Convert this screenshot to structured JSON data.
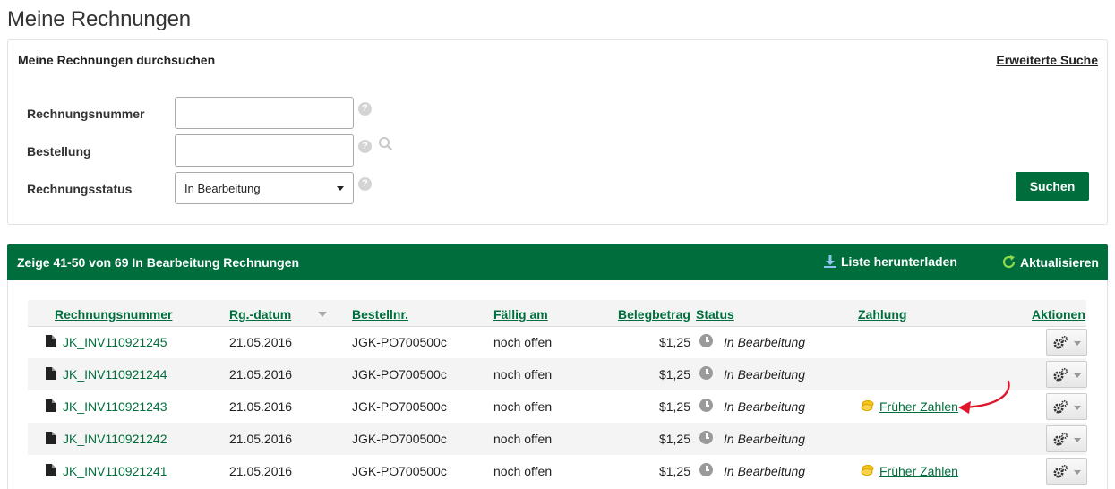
{
  "page": {
    "title": "Meine Rechnungen"
  },
  "search": {
    "title": "Meine Rechnungen durchsuchen",
    "advanced_link": "Erweiterte Suche",
    "fields": {
      "invoice_number_label": "Rechnungsnummer",
      "invoice_number_value": "",
      "order_label": "Bestellung",
      "order_value": "",
      "status_label": "Rechnungsstatus",
      "status_value": "In Bearbeitung"
    },
    "help_glyph": "?",
    "submit_label": "Suchen"
  },
  "results": {
    "summary": "Zeige 41-50 von 69 In Bearbeitung Rechnungen",
    "download_label": "Liste herunterladen",
    "refresh_label": "Aktualisieren",
    "columns": {
      "invoice": "Rechnungsnummer",
      "date": "Rg.-datum",
      "order": "Bestellnr.",
      "due": "Fällig am",
      "amount": "Belegbetrag",
      "status": "Status",
      "payment": "Zahlung",
      "actions": "Aktionen"
    },
    "rows": [
      {
        "invoice": "JK_INV110921245",
        "date": "21.05.2016",
        "order": "JGK-PO700500c",
        "due": "noch offen",
        "amount": "$1,25",
        "status": "In Bearbeitung",
        "payment": ""
      },
      {
        "invoice": "JK_INV110921244",
        "date": "21.05.2016",
        "order": "JGK-PO700500c",
        "due": "noch offen",
        "amount": "$1,25",
        "status": "In Bearbeitung",
        "payment": ""
      },
      {
        "invoice": "JK_INV110921243",
        "date": "21.05.2016",
        "order": "JGK-PO700500c",
        "due": "noch offen",
        "amount": "$1,25",
        "status": "In Bearbeitung",
        "payment": "Früher Zahlen"
      },
      {
        "invoice": "JK_INV110921242",
        "date": "21.05.2016",
        "order": "JGK-PO700500c",
        "due": "noch offen",
        "amount": "$1,25",
        "status": "In Bearbeitung",
        "payment": ""
      },
      {
        "invoice": "JK_INV110921241",
        "date": "21.05.2016",
        "order": "JGK-PO700500c",
        "due": "noch offen",
        "amount": "$1,25",
        "status": "In Bearbeitung",
        "payment": "Früher Zahlen"
      }
    ]
  },
  "colors": {
    "brand_green": "#006e3c",
    "annotation_red": "#e0152a",
    "coin_yellow": "#f5c518"
  },
  "icons": [
    "help-icon",
    "search-icon",
    "download-icon",
    "refresh-icon",
    "document-icon",
    "clock-icon",
    "coins-icon",
    "gear-icon",
    "chevron-down-icon",
    "annotation-arrow"
  ]
}
